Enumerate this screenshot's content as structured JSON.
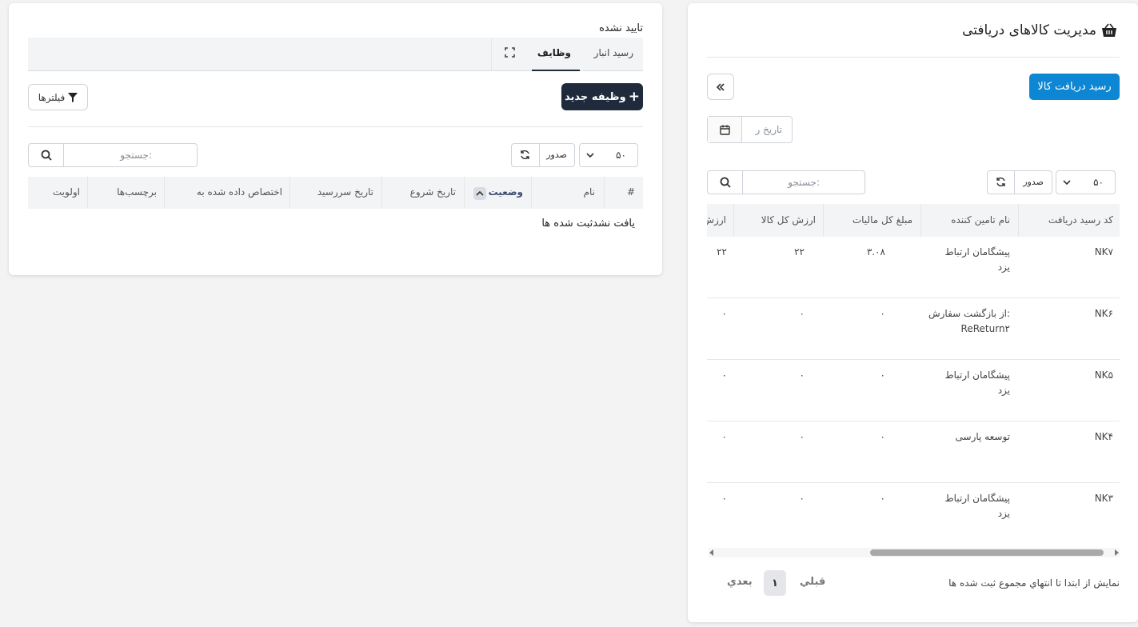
{
  "tasks": {
    "status_label": "تایید نشده",
    "tabs": [
      {
        "label": "رسید انبار"
      },
      {
        "label": "وظایف"
      }
    ],
    "new_task_label": "وظیفه جدید",
    "filters_label": "فیلترها",
    "page_size": "۵۰",
    "export_label": "صدور",
    "search_placeholder": "جستجو:",
    "columns": [
      "#",
      "نام",
      "وضعیت",
      "تاریخ شروع",
      "تاریخ سررسید",
      "اختصاص داده شده به",
      "برچسب‌ها",
      "اولویت"
    ],
    "empty_message": "یافت نشدثبت شده ها"
  },
  "receipts": {
    "title": "مدیریت کالاهای دریافتی",
    "receive_button_label": "رسید دریافت کالا",
    "date_placeholder": "تاریخ ر",
    "page_size": "۵۰",
    "export_label": "صدور",
    "search_placeholder": "جستجو:",
    "columns": [
      "کد رسید دریافت",
      "نام تامین کننده",
      "مبلغ کل مالیات",
      "ارزش کل کالا",
      "ارزش"
    ],
    "rows": [
      {
        "code": "NK۷",
        "supplier_line1": "پیشگامان ارتباط",
        "supplier_line2": "یزد",
        "tax": "۳.۰۸",
        "total": "۲۲",
        "value": "۲۲"
      },
      {
        "code": "NK۶",
        "supplier_line1": "از بازگشت سفارش:",
        "supplier_line2": "ReReturn۲",
        "tax": "۰",
        "total": "۰",
        "value": "۰"
      },
      {
        "code": "NK۵",
        "supplier_line1": "پیشگامان ارتباط",
        "supplier_line2": "یزد",
        "tax": "۰",
        "total": "۰",
        "value": "۰"
      },
      {
        "code": "NK۴",
        "supplier_line1": "توسعه پارسی",
        "supplier_line2": "",
        "tax": "۰",
        "total": "۰",
        "value": "۰"
      },
      {
        "code": "NK۳",
        "supplier_line1": "پیشگامان ارتباط",
        "supplier_line2": "یزد",
        "tax": "۰",
        "total": "۰",
        "value": "۰"
      }
    ],
    "pagination_info": "نمایش از ابتدا تا انتهاي مجموع ثبت شده ها",
    "prev_label": "قبلي",
    "current_page": "۱",
    "next_label": "بعدي",
    "accent_color": "#0d86d4"
  }
}
